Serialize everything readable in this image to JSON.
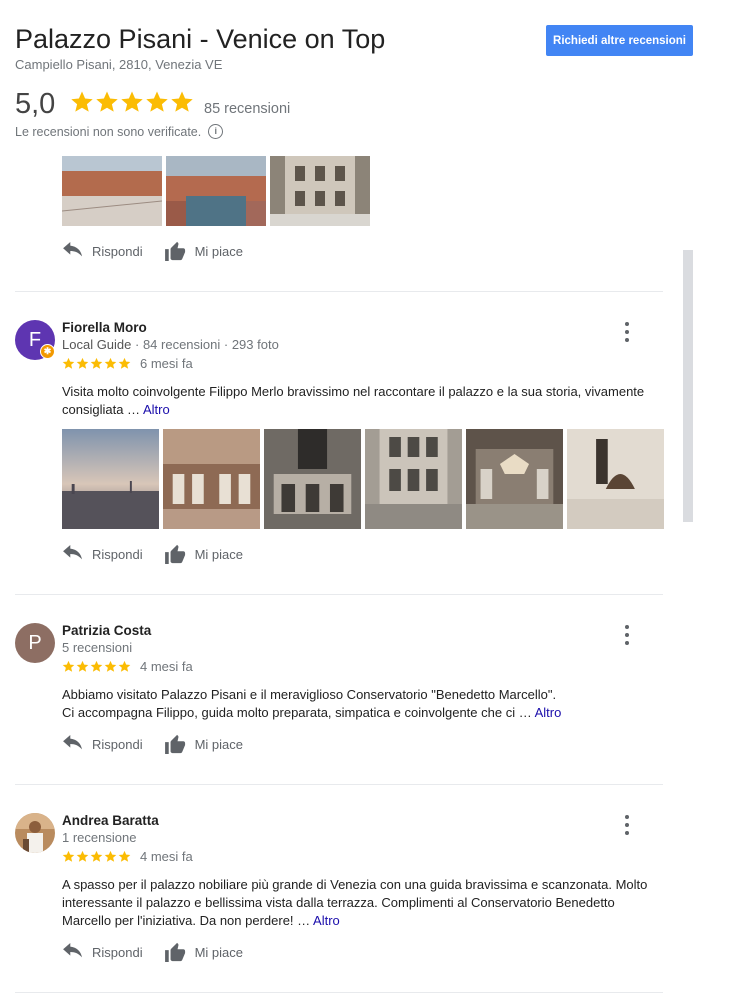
{
  "place": {
    "title": "Palazzo Pisani - Venice on Top",
    "address": "Campiello Pisani, 2810, Venezia VE",
    "rating": "5,0",
    "review_count": "85 recensioni",
    "unverified_note": "Le recensioni non sono verificate.",
    "request_button": "Richiedi altre recensioni",
    "stars": 5
  },
  "actions": {
    "reply": "Rispondi",
    "like": "Mi piace"
  },
  "more_label": "Altro",
  "reviews": [
    {
      "initial": "F",
      "avatar_color": "#5e35b1",
      "name": "Fiorella Moro",
      "guide": "Local Guide",
      "stats": " · 84 recensioni · 293 foto",
      "date": "6 mesi fa",
      "text": "Visita molto coinvolgente Filippo Merlo bravissimo nel raccontare il palazzo e la sua storia, vivamente consigliata … ",
      "stars": 5
    },
    {
      "initial": "P",
      "avatar_color": "#8d6e63",
      "name": "Patrizia Costa",
      "stats": "5 recensioni",
      "date": "4 mesi fa",
      "text_line1": "Abbiamo visitato Palazzo Pisani e il meraviglioso Conservatorio \"Benedetto Marcello\".",
      "text_line2": "Ci accompagna Filippo, guida molto preparata, simpatica e coinvolgente che ci … ",
      "stars": 5
    },
    {
      "name": "Andrea Baratta",
      "stats": "1 recensione",
      "date": "4 mesi fa",
      "text": "A spasso per il palazzo nobiliare più grande di Venezia con una guida bravissima e scanzonata. Molto interessante il palazzo e bellissima vista dalla terrazza. Complimenti al Conservatorio Benedetto Marcello per l'iniziativa. Da non perdere! … ",
      "stars": 5
    }
  ],
  "colors": {
    "star": "#fbbc04",
    "accent": "#4285f4",
    "link": "#1a0dab"
  },
  "icons": [
    "star-icon",
    "info-icon",
    "reply-icon",
    "thumb-up-icon",
    "more-vert-icon",
    "chevron-right-icon"
  ]
}
